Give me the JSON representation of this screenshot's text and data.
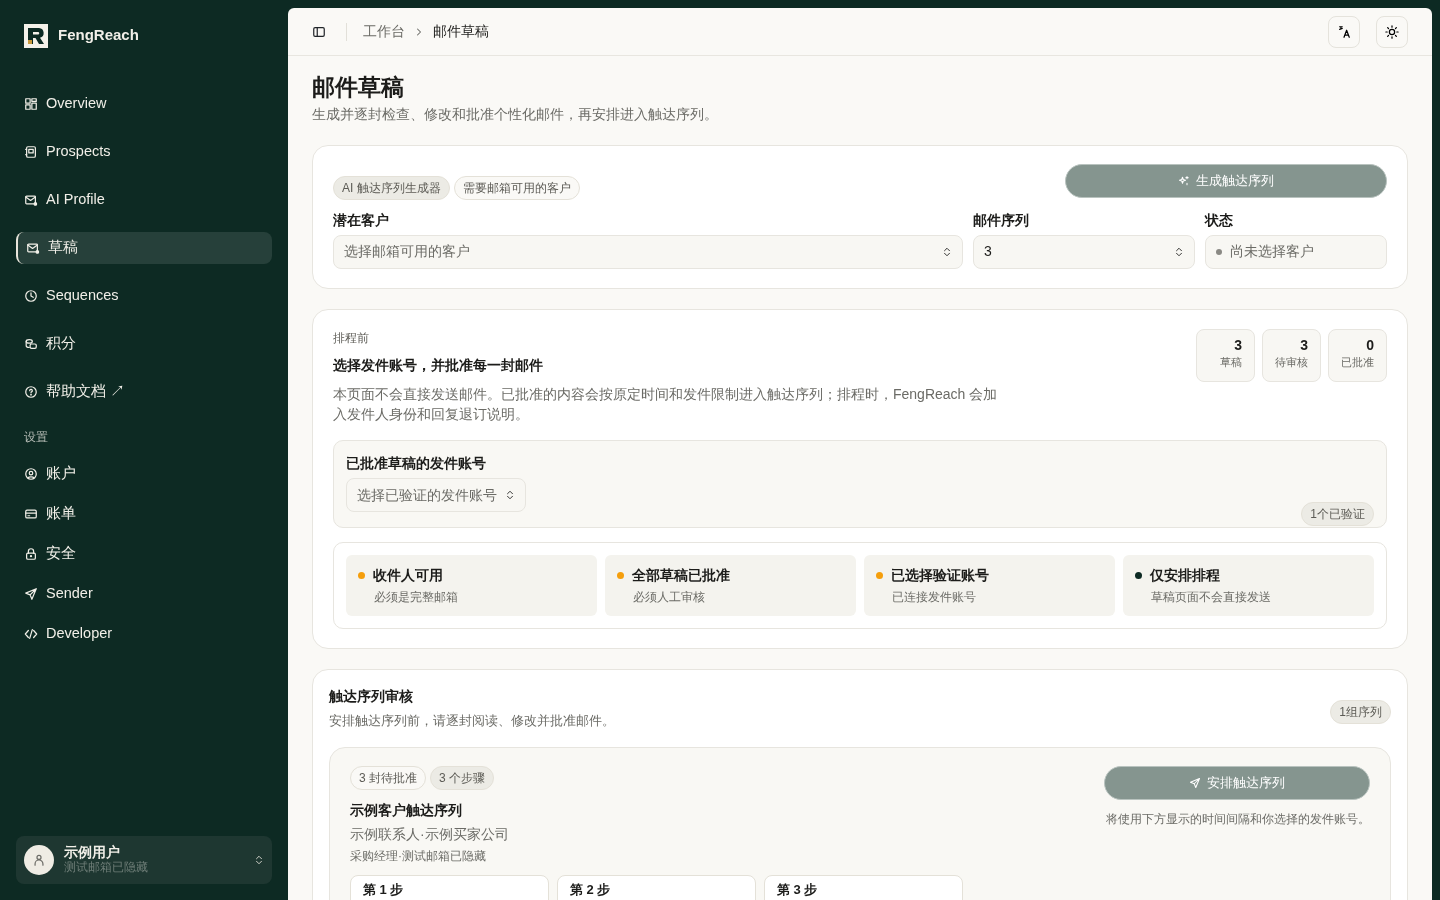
{
  "sidebar": {
    "brand": "FengReach",
    "nav_items": [
      {
        "label": "Overview",
        "selected": false
      },
      {
        "label": "Prospects",
        "selected": false
      },
      {
        "label": "AI Profile",
        "selected": false
      },
      {
        "label": "草稿",
        "selected": true
      },
      {
        "label": "Sequences",
        "selected": false
      },
      {
        "label": "积分",
        "selected": false
      },
      {
        "label": "帮助文档 ↗",
        "selected": false
      }
    ],
    "settings_label": "设置",
    "settings_items": [
      {
        "label": "账户",
        "selected": false
      },
      {
        "label": "账单",
        "selected": false
      },
      {
        "label": "安全",
        "selected": false
      },
      {
        "label": "Sender",
        "selected": false
      },
      {
        "label": "Developer",
        "selected": false
      }
    ],
    "user": {
      "name": "示例用户",
      "email": "测试邮箱已隐藏"
    }
  },
  "header": {
    "breadcrumb": [
      "工作台",
      "邮件草稿"
    ]
  },
  "page": {
    "title": "邮件草稿",
    "subtitle": "生成并逐封检查、修改和批准个性化邮件，再安排进入触达序列。"
  },
  "generator": {
    "tags": [
      "AI 触达序列生成器",
      "需要邮箱可用的客户"
    ],
    "button": {
      "label": "生成触达序列",
      "disabled": true
    },
    "prospect": {
      "label": "潜在客户",
      "placeholder": "选择邮箱可用的客户"
    },
    "sequence": {
      "label": "邮件序列",
      "value": "3"
    },
    "status": {
      "label": "状态",
      "value": "尚未选择客户"
    }
  },
  "schedule": {
    "eyebrow": "排程前",
    "title": "选择发件账号，并批准每一封邮件",
    "description": "本页面不会直接发送邮件。已批准的内容会按原定时间和发件限制进入触达序列；排程时，FengReach 会加入发件人身份和回复退订说明。",
    "stats": [
      {
        "value": "3",
        "label": "草稿"
      },
      {
        "value": "3",
        "label": "待审核"
      },
      {
        "value": "0",
        "label": "已批准"
      }
    ],
    "sender": {
      "label": "已批准草稿的发件账号",
      "placeholder": "选择已验证的发件账号",
      "badge": "1个已验证"
    },
    "checks": [
      {
        "title": "收件人可用",
        "desc": "必须是完整邮箱",
        "color": "#f59e0b"
      },
      {
        "title": "全部草稿已批准",
        "desc": "必须人工审核",
        "color": "#f59e0b"
      },
      {
        "title": "已选择验证账号",
        "desc": "已连接发件账号",
        "color": "#f59e0b"
      },
      {
        "title": "仅安排排程",
        "desc": "草稿页面不会直接发送",
        "color": "#0d2a23"
      }
    ]
  },
  "review": {
    "title": "触达序列审核",
    "subtitle": "安排触达序列前，请逐封阅读、修改并批准邮件。",
    "badge": "1组序列",
    "sequence": {
      "tags": [
        "3 封待批准",
        "3 个步骤"
      ],
      "title": "示例客户触达序列",
      "contact": "示例联系人·示例买家公司",
      "role": "采购经理·测试邮箱已隐藏",
      "button": {
        "label": "安排触达序列",
        "disabled": true
      },
      "note": "将使用下方显示的时间间隔和你选择的发件账号。",
      "steps": [
        "第 1 步",
        "第 2 步",
        "第 3 步"
      ]
    }
  }
}
